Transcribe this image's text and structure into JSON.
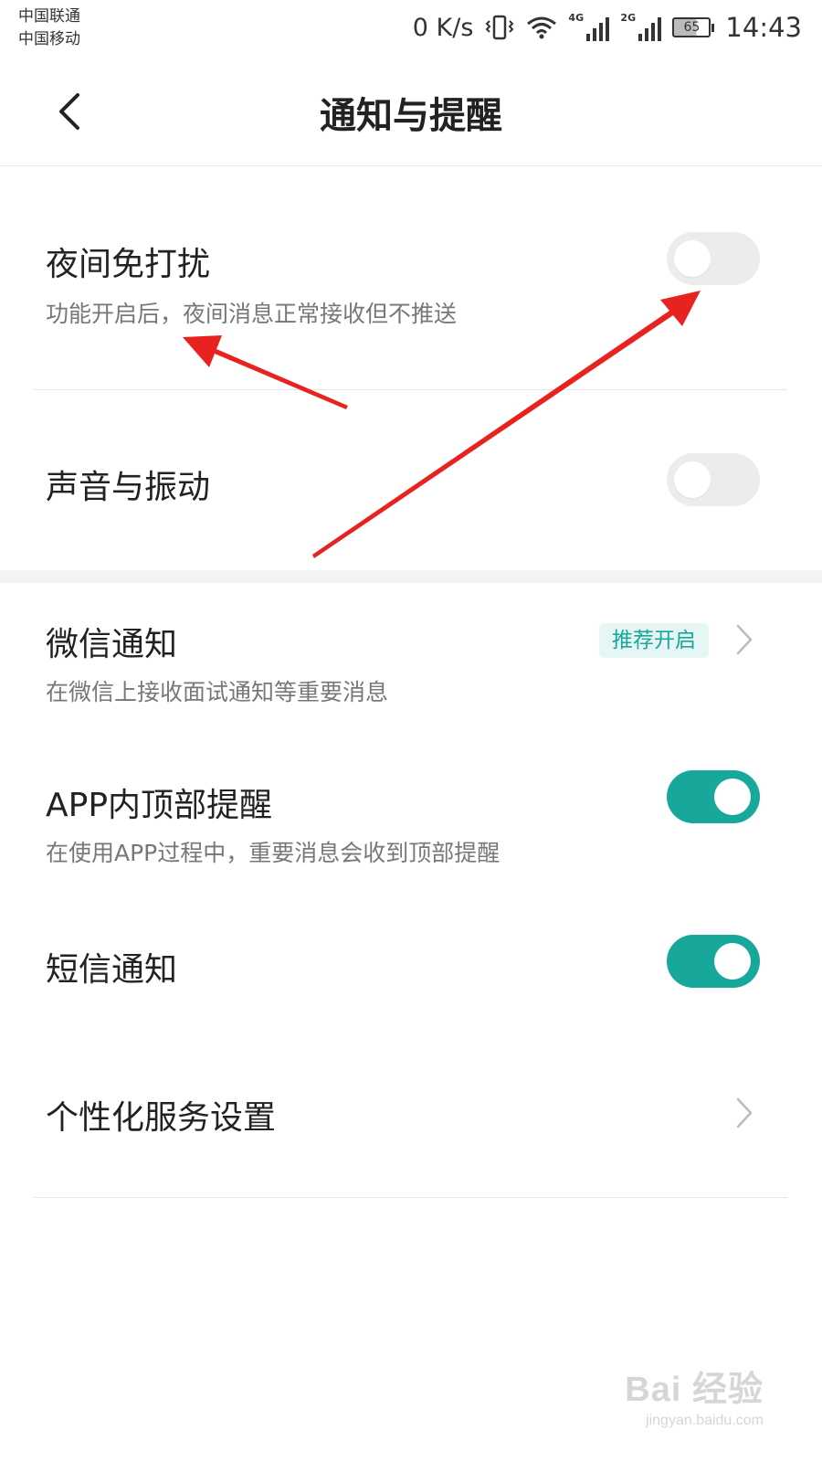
{
  "status_bar": {
    "carrier_1": "中国联通",
    "carrier_2": "中国移动",
    "net_speed": "0 K/s",
    "signal_1_tag": "4G",
    "signal_2_tag": "2G",
    "battery": "65",
    "time": "14:43",
    "icons": [
      "vibrate-icon",
      "wifi-icon",
      "signal-4g-icon",
      "signal-2g-icon",
      "battery-icon"
    ]
  },
  "nav": {
    "title": "通知与提醒",
    "back_icon": "chevron-left-icon"
  },
  "settings": {
    "night_dnd": {
      "title": "夜间免打扰",
      "subtitle": "功能开启后，夜间消息正常接收但不推送",
      "enabled": false
    },
    "sound_vibration": {
      "title": "声音与振动",
      "enabled": false
    },
    "wechat_notify": {
      "title": "微信通知",
      "subtitle": "在微信上接收面试通知等重要消息",
      "badge": "推荐开启"
    },
    "in_app_top": {
      "title": "APP内顶部提醒",
      "subtitle": "在使用APP过程中，重要消息会收到顶部提醒",
      "enabled": true
    },
    "sms_notify": {
      "title": "短信通知",
      "enabled": true
    },
    "personalized": {
      "title": "个性化服务设置"
    }
  },
  "colors": {
    "accent": "#17a79b",
    "switch_off": "#ececec",
    "annotation_arrow": "#e8231f"
  },
  "watermark": {
    "logo": "Bai 经验",
    "url": "jingyan.baidu.com"
  }
}
